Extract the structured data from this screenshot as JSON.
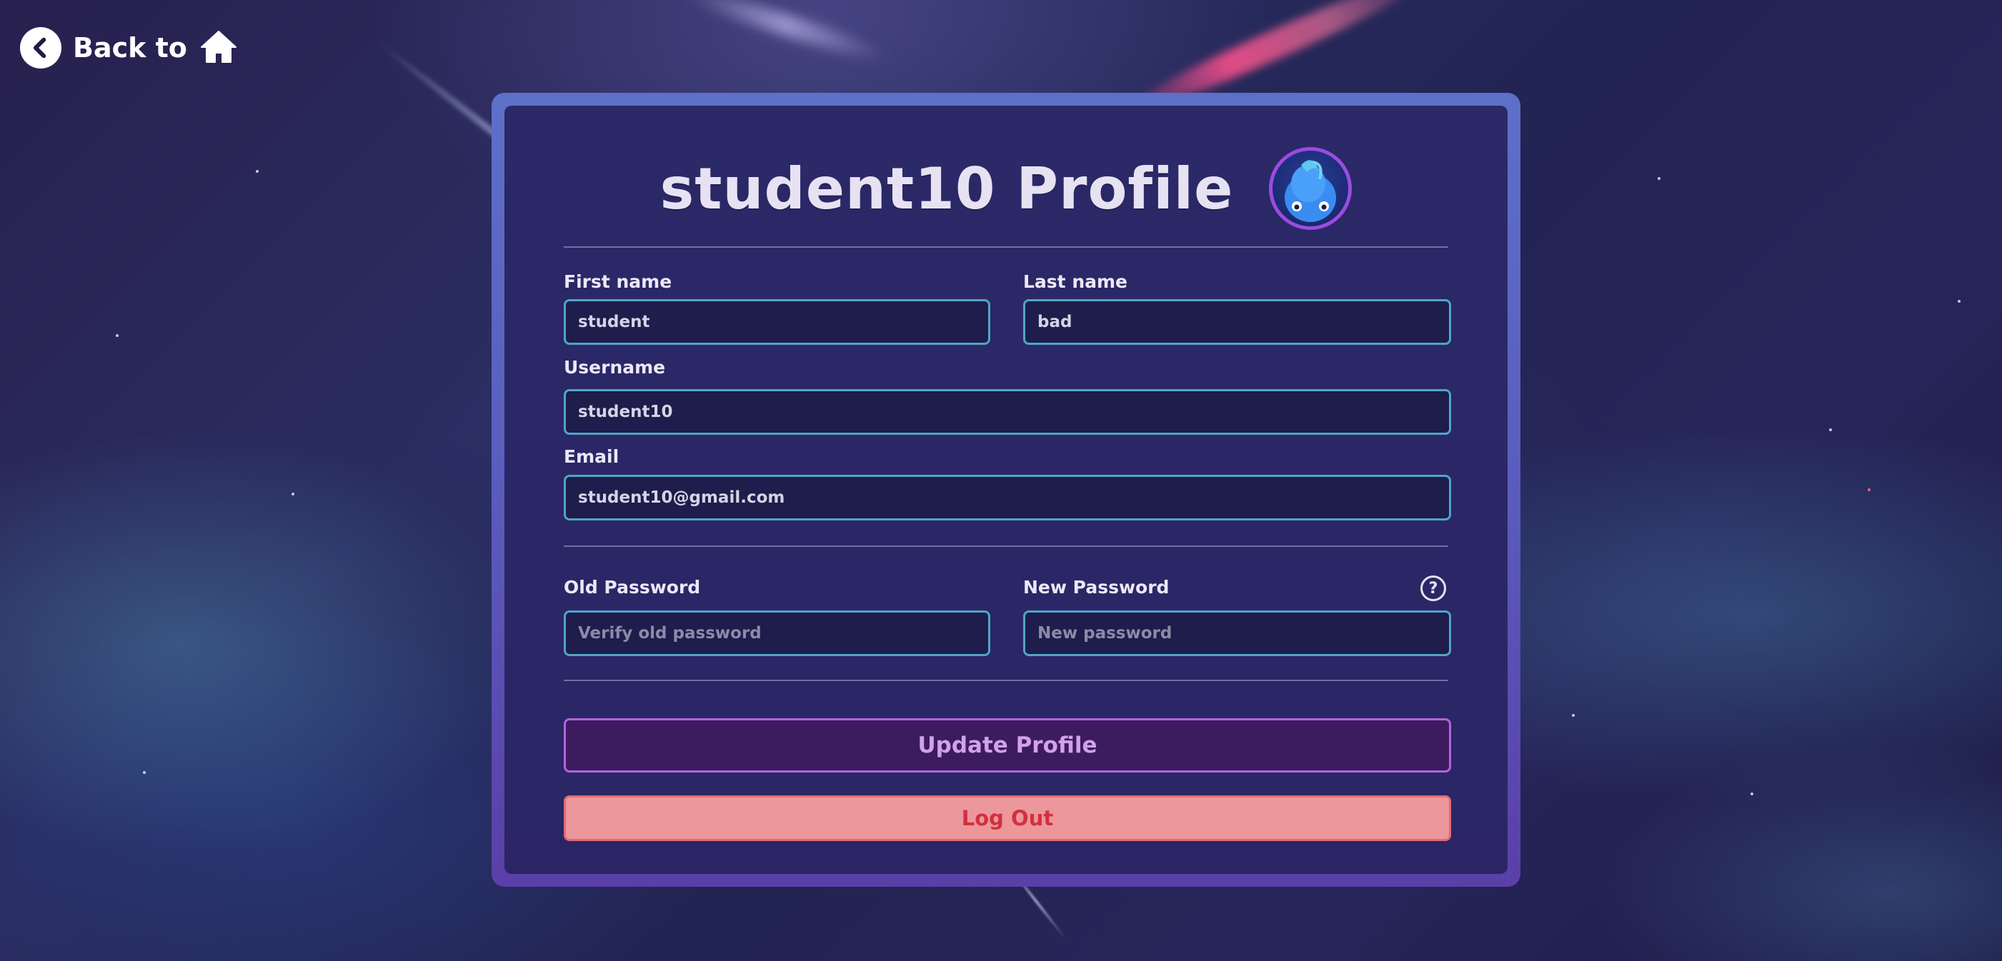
{
  "nav": {
    "back_label": "Back to",
    "back_icon": "chevron-left-icon",
    "home_icon": "home-icon"
  },
  "profile": {
    "title": "student10 Profile",
    "avatar_icon": "avatar-icon"
  },
  "form": {
    "first_name": {
      "label": "First name",
      "value": "student"
    },
    "last_name": {
      "label": "Last name",
      "value": "bad"
    },
    "username": {
      "label": "Username",
      "value": "student10"
    },
    "email": {
      "label": "Email",
      "value": "student10@gmail.com"
    },
    "old_password": {
      "label": "Old Password",
      "value": "",
      "placeholder": "Verify old password"
    },
    "new_password": {
      "label": "New Password",
      "value": "",
      "placeholder": "New password"
    },
    "help_symbol": "?"
  },
  "actions": {
    "update_label": "Update Profile",
    "logout_label": "Log Out"
  },
  "colors": {
    "card_border": "#5a5cbd",
    "field_border": "#4fa6c4",
    "update_border": "#b064e0",
    "update_text": "#d2a0ec",
    "logout_bg": "#eb979c",
    "logout_text": "#d2303e"
  }
}
